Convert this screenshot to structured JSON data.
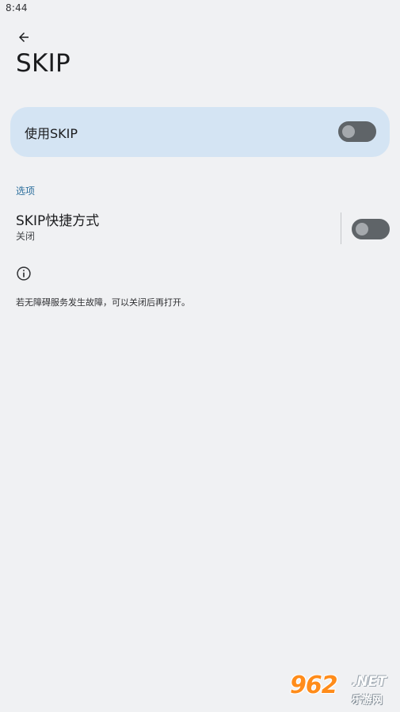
{
  "status_bar": {
    "time": "8:44"
  },
  "header": {
    "back_icon": "arrow-left-icon",
    "title": "SKIP"
  },
  "main_switch": {
    "label": "使用SKIP",
    "checked": false
  },
  "options": {
    "section_title": "选项",
    "shortcut": {
      "title": "SKIP快捷方式",
      "summary": "关闭",
      "checked": false
    }
  },
  "info": {
    "icon": "info-icon",
    "note": "若无障碍服务发生故障，可以关闭后再打开。"
  },
  "watermark": {
    "logo": "962",
    "net": ".NET",
    "sub": "乐游网"
  },
  "colors": {
    "background": "#f0f1f3",
    "card": "#d4e4f3",
    "accent": "#2b6e9c",
    "toggle_track": "#5f6468",
    "toggle_knob": "#a5a9ad"
  }
}
